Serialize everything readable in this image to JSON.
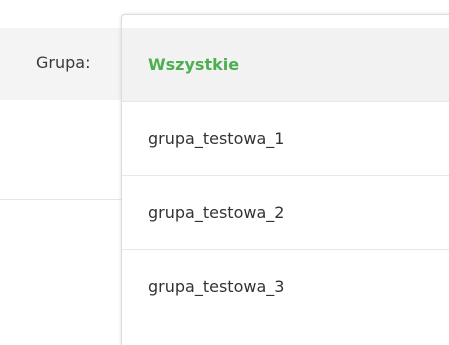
{
  "filter": {
    "label": "Grupa:"
  },
  "dropdown": {
    "options": [
      {
        "label": "Wszystkie"
      },
      {
        "label": "grupa_testowa_1"
      },
      {
        "label": "grupa_testowa_2"
      },
      {
        "label": "grupa_testowa_3"
      }
    ],
    "selected_color": "#4caf50"
  }
}
